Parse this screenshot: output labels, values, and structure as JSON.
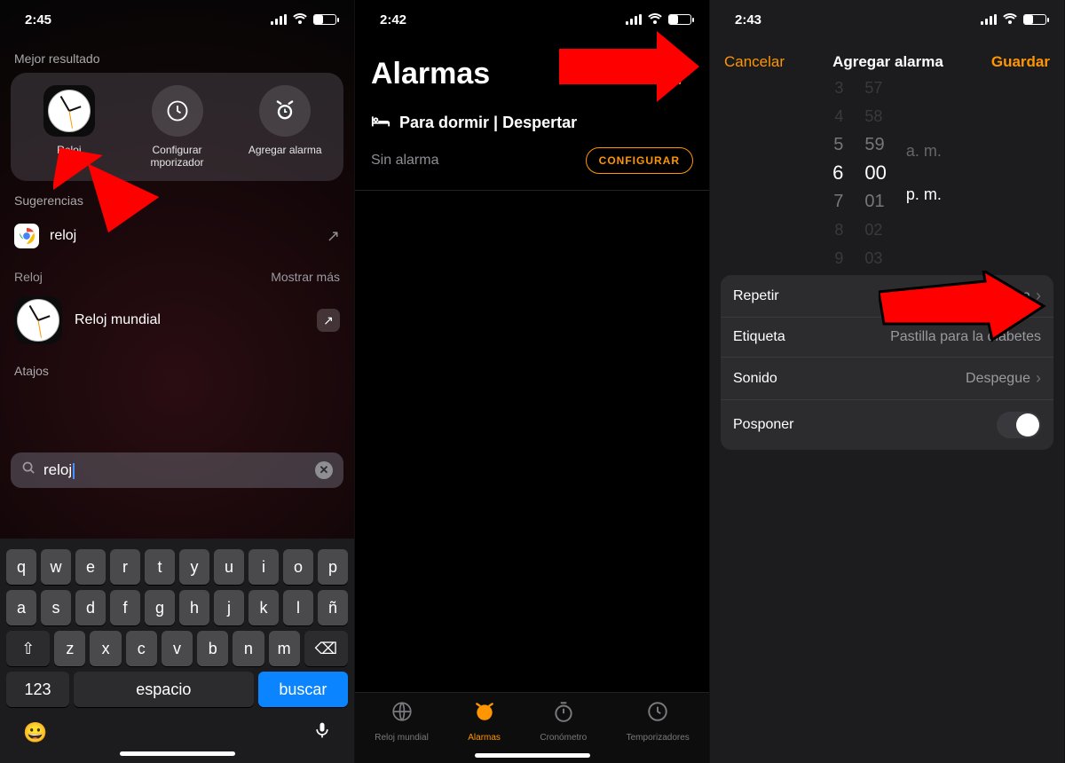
{
  "colors": {
    "accent": "#ff9500",
    "blue": "#0a84ff",
    "arrow": "#fe0000"
  },
  "panel1": {
    "time": "2:45",
    "section_best": "Mejor resultado",
    "hits": {
      "reloj": "Reloj",
      "timer": "Configurar mporizador",
      "addalarm": "Agregar alarma"
    },
    "section_sugg": "Sugerencias",
    "sugg_chrome": "reloj",
    "section_app": "Reloj",
    "show_more": "Mostrar más",
    "world_clock": "Reloj mundial",
    "section_shortcuts": "Atajos",
    "search_value": "reloj",
    "kb": {
      "row1": [
        "q",
        "w",
        "e",
        "r",
        "t",
        "y",
        "u",
        "i",
        "o",
        "p"
      ],
      "row2": [
        "a",
        "s",
        "d",
        "f",
        "g",
        "h",
        "j",
        "k",
        "l",
        "ñ"
      ],
      "row3": [
        "z",
        "x",
        "c",
        "v",
        "b",
        "n",
        "m"
      ],
      "shift": "⇧",
      "backspace": "⌫",
      "numbers": "123",
      "space": "espacio",
      "search": "buscar",
      "emoji": "😀",
      "mic": "🎤"
    }
  },
  "panel2": {
    "time": "2:42",
    "title": "Alarmas",
    "sleep_label": "Para dormir | Despertar",
    "no_alarm": "Sin alarma",
    "configure": "CONFIGURAR",
    "tabs": {
      "world": "Reloj mundial",
      "alarms": "Alarmas",
      "stopwatch": "Cronómetro",
      "timers": "Temporizadores"
    }
  },
  "panel3": {
    "time": "2:43",
    "cancel": "Cancelar",
    "title": "Agregar alarma",
    "save": "Guardar",
    "picker": {
      "hours": [
        "3",
        "4",
        "5",
        "6",
        "7",
        "8",
        "9"
      ],
      "mins": [
        "57",
        "58",
        "59",
        "00",
        "01",
        "02",
        "03"
      ],
      "am": "a. m.",
      "pm": "p. m."
    },
    "opts": {
      "repeat_label": "Repetir",
      "repeat_value": "Nunca",
      "tag_label": "Etiqueta",
      "tag_value": "Pastilla para la diabetes",
      "sound_label": "Sonido",
      "sound_value": "Despegue",
      "snooze_label": "Posponer"
    }
  }
}
